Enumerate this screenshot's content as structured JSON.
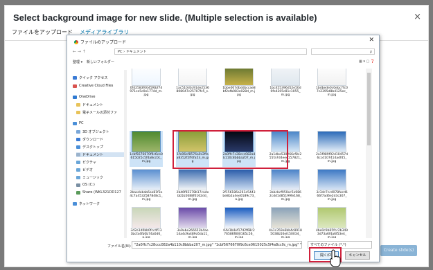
{
  "modal": {
    "title": "Select background image for new slide. (Multiple selection is available)",
    "close_glyph": "×",
    "tabs": [
      {
        "label": "ファイルをアップロード",
        "active": true
      },
      {
        "label": "メディアライブラリ",
        "active": false
      }
    ],
    "insert_button": "Create slide(s)"
  },
  "dialog": {
    "title": "ファイルのアップロード",
    "close_glyph": "✕",
    "nav_arrows": "← → ↑",
    "path": "PC › ドキュメント",
    "search_placeholder": "ρ",
    "organize": "整理 ▾",
    "new_folder": "新しいフォルダー",
    "view_controls": "▦ ▾  ▢  ❓",
    "nav_items": [
      {
        "label": "クイック アクセス",
        "color": "#3a7bd5"
      },
      {
        "label": "Creative Cloud Files",
        "color": "#d9534f"
      },
      {
        "label": "OneDrive",
        "color": "#2f7ad1"
      },
      {
        "label": "ドキュメント",
        "color": "#e8c35a"
      },
      {
        "label": "電子メールの添付ファ",
        "color": "#e8c35a"
      },
      {
        "label": "PC",
        "color": "#4a8fd8"
      },
      {
        "label": "3D オブジェクト",
        "color": "#7aa7d8"
      },
      {
        "label": "ダウンロード",
        "color": "#3a7bd5"
      },
      {
        "label": "デスクトップ",
        "color": "#4a8fd8"
      },
      {
        "label": "ドキュメント",
        "color": "#9bb3cc",
        "selected": true
      },
      {
        "label": "ピクチャ",
        "color": "#6aa6d8"
      },
      {
        "label": "ビデオ",
        "color": "#6aa6d8"
      },
      {
        "label": "ミュージック",
        "color": "#6aa6d8"
      },
      {
        "label": "OS (C:)",
        "color": "#7a8fa3"
      },
      {
        "label": "Share (WKL321DD127",
        "color": "#5a9a5a"
      },
      {
        "label": "ネットワーク",
        "color": "#4a8fd8"
      }
    ],
    "files": [
      {
        "name": "0f42583f0045f6bf74971ce5c0e1774d_m.jpg",
        "colors": [
          "#ffffff",
          "#eef6ff"
        ]
      },
      {
        "name": "1ac510d3c91de2536808047c25707fc5_s.jpg",
        "colors": [
          "#ffffff",
          "#f4f4f4"
        ]
      },
      {
        "name": "1bbe007dbddbccae8bf2efb083e028d_m.jpg",
        "colors": [
          "#5a6e2d",
          "#c8b24a"
        ]
      },
      {
        "name": "1bc455396d52e50d0fe4205c81c1055_m.jpg",
        "colors": [
          "#f2f5f8",
          "#dfe7ee"
        ]
      },
      {
        "name": "1bdbede0c0ebc7fc07c2395d8b4125ec_m.jpg",
        "colors": [
          "#ffffff",
          "#f1f1f1"
        ]
      },
      {
        "name": "1cbf5676670f9c6ce0615025c5f4a8cc0c_m.jpg",
        "colors": [
          "#4f8a2f",
          "#9db56a"
        ],
        "selected": true
      },
      {
        "name": "1fe06ef8576a0c2ffaa8352f2ffdfa53_m.jpg",
        "colors": [
          "#8a9e3a",
          "#d2c46a"
        ],
        "selected": true
      },
      {
        "name": "2a0ffc7c28ccc082a4b110c8bbba207_m.jpg",
        "colors": [
          "#050812",
          "#2a3a6a"
        ],
        "selected": true
      },
      {
        "name": "2a1dba530266cf8c255fa7d4eee157821_m.jpg",
        "colors": [
          "#4a86c8",
          "#d8e8f6"
        ]
      },
      {
        "name": "2a1f989f92d10457d6ccd107414adfd5_m.jpg",
        "colors": [
          "#2b6ab8",
          "#e4eef8"
        ]
      },
      {
        "name": "2baedebab6ee81f3e4c7a4532587848c1_m.jpg",
        "colors": [
          "#5a8fd0",
          "#e8f0f8"
        ]
      },
      {
        "name": "2bd6f92278b17cadebb5b5688f0162dd_m.jpg",
        "colors": [
          "#3c6cb0",
          "#f4f6f8"
        ]
      },
      {
        "name": "2f156186a261e5443be8b2a4ee0189c73_a.jpg",
        "colors": [
          "#2a5caa",
          "#c8daf0"
        ]
      },
      {
        "name": "3abcbcf950ec5e9862cdd1d85199fe168_m.jpg",
        "colors": [
          "#4a82c8",
          "#e8eef6"
        ]
      },
      {
        "name": "3c3dc7cc4078fecd666f7ad6e2d3c307_m.jpg",
        "colors": [
          "#3c78c4",
          "#d6e4f4"
        ]
      },
      {
        "name": "3d2e1d0bb0fcc4f133bcfa4fb0b74a0d6_a.jpg",
        "colors": [
          "#c8d6b8",
          "#f4e8ea"
        ]
      },
      {
        "name": "3e9ebe266652b4ae14a4c9a489c6da11_m.jpg",
        "colors": [
          "#6a4aa8",
          "#e0d8ec"
        ]
      },
      {
        "name": "04e1b4ef17d2f68c276586f800165c56_m.jpg",
        "colors": [
          "#1a5cc0",
          "#f6f8fc"
        ]
      },
      {
        "name": "4a1c359e6bb4c89185038b50efc50034_m.jpg",
        "colors": [
          "#8aa2b8",
          "#e8e4d8"
        ]
      },
      {
        "name": "4be0c9b65fcc2b3493d73a6f4a6f53e4_m.jpg",
        "colors": [
          "#b0c870",
          "#dce8c0"
        ]
      }
    ],
    "filename_label": "ファイル名(N):",
    "filename_value": "\"2a0ffc7c28ccc082a4b110c8bbba207_m.jpg\" \"1cbf5676670f9c6ce0615025c5f4a8cc0c_m.jpg\" \"1fe0",
    "filetype_value": "すべてのファイル (*.*)",
    "open_button": "開く(O)",
    "cancel_button": "キャンセル"
  },
  "colors": {
    "highlight": "#d0203b",
    "accent": "#0073aa"
  }
}
